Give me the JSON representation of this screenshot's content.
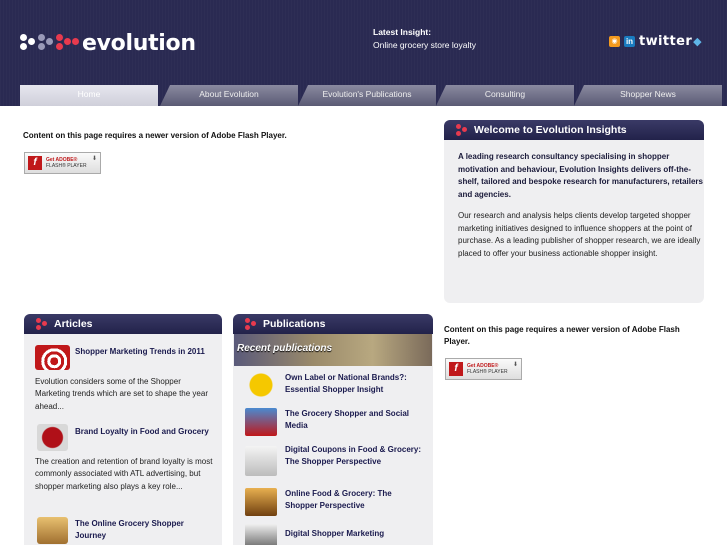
{
  "header": {
    "logo_text": "evolution",
    "latest_insight_title": "Latest Insight:",
    "latest_insight_text": "Online grocery store loyalty",
    "social": {
      "rss_icon": "rss-icon",
      "linkedin_label": "in",
      "twitter_label": "twitter"
    }
  },
  "nav": {
    "tabs": [
      {
        "label": "Home"
      },
      {
        "label": "About Evolution"
      },
      {
        "label": "Evolution's Publications"
      },
      {
        "label": "Consulting"
      },
      {
        "label": "Shopper News"
      }
    ]
  },
  "flash": {
    "message_left": "Content on this page requires a newer version of Adobe Flash Player.",
    "message_right": "Content on this page requires a newer version of Adobe Flash Player.",
    "badge_get": "Get ADOBE®",
    "badge_product": "FLASH® PLAYER",
    "badge_icon": "f"
  },
  "welcome": {
    "title": "Welcome to Evolution Insights",
    "lead": "A leading research consultancy specialising in shopper motivation and behaviour, Evolution Insights delivers off-the-shelf, tailored and bespoke research for manufacturers, retailers and agencies.",
    "body": "Our research and analysis helps clients develop targeted shopper marketing initiatives designed to influence shoppers at the point of purchase. As a leading publisher of shopper research, we are ideally placed to offer your business actionable shopper insight."
  },
  "articles": {
    "title": "Articles",
    "items": [
      {
        "title": "Shopper Marketing Trends in 2011",
        "desc": "Evolution considers some of the Shopper Marketing trends which are set to shape the year ahead..."
      },
      {
        "title": "Brand Loyalty in Food and Grocery",
        "desc": "The creation and retention of brand loyalty is most commonly associated with ATL advertising, but shopper marketing also plays a key role..."
      },
      {
        "title": "The Online Grocery Shopper Journey",
        "desc": ""
      }
    ]
  },
  "publications": {
    "title": "Publications",
    "banner": "Recent publications",
    "items": [
      {
        "title": "Own Label or National Brands?: Essential Shopper Insight"
      },
      {
        "title": "The Grocery Shopper and Social Media"
      },
      {
        "title": "Digital Coupons in Food & Grocery: The Shopper Perspective"
      },
      {
        "title": "Online Food & Grocery: The Shopper Perspective"
      },
      {
        "title": "Digital Shopper Marketing"
      }
    ]
  },
  "colors": {
    "header_bg": "#2a2a52",
    "accent_red": "#e83a4e",
    "panel_head": "#22224a"
  }
}
